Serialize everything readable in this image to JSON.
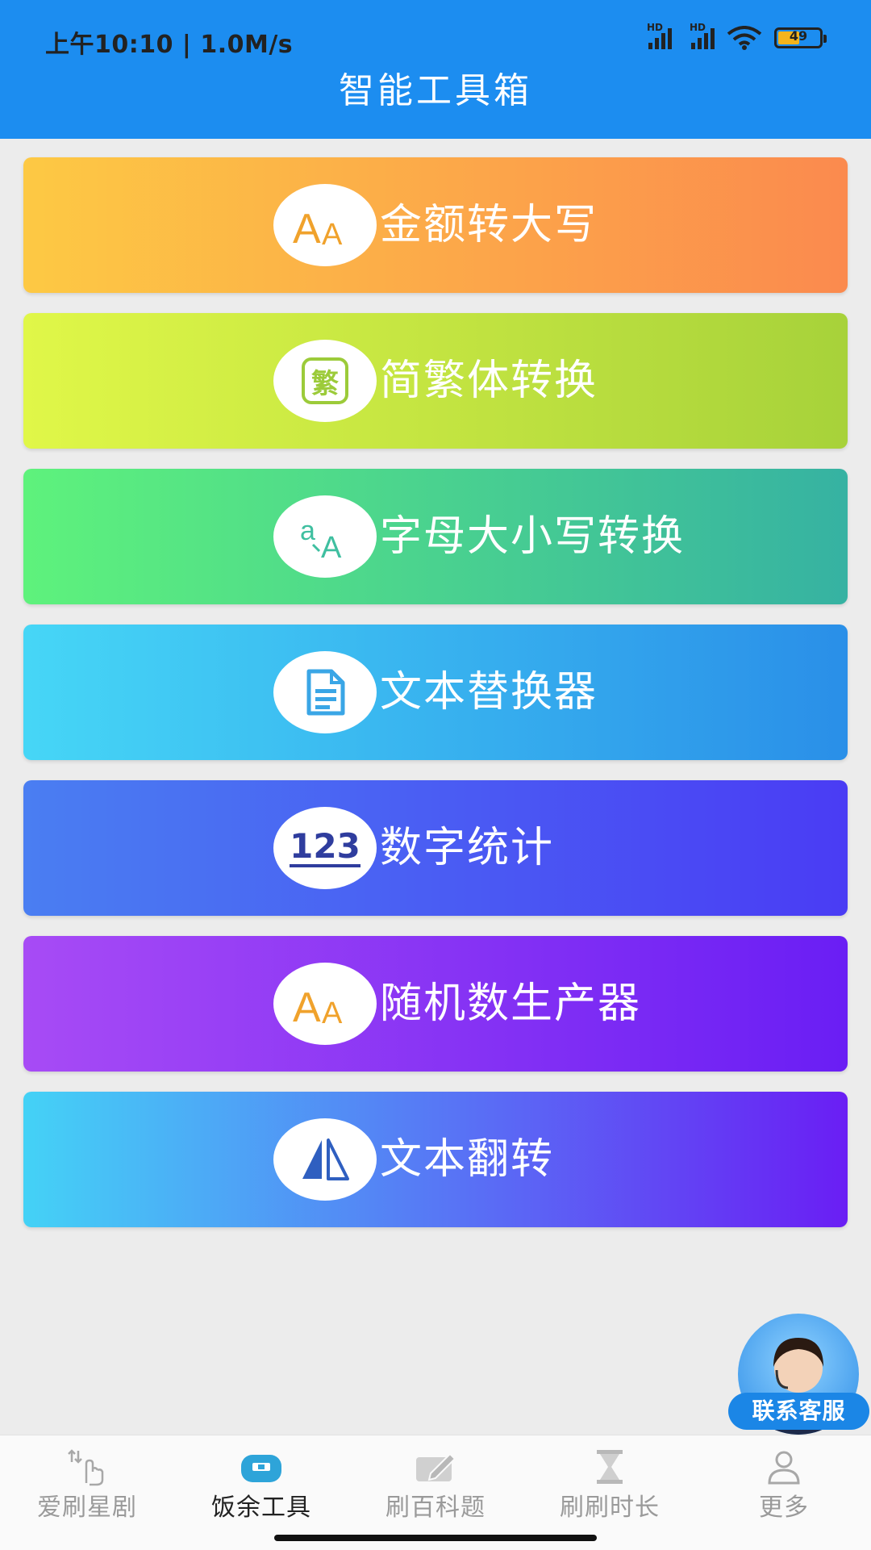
{
  "status": {
    "time": "上午10:10 | 1.0M/s",
    "battery": "49",
    "hd1": "HD",
    "hd2": "HD"
  },
  "header": {
    "title": "智能工具箱"
  },
  "tools": [
    {
      "label": "金额转大写",
      "icon": "font-aa-icon"
    },
    {
      "label": "简繁体转换",
      "icon": "traditional-char-icon",
      "icon_text": "繁"
    },
    {
      "label": "字母大小写转换",
      "icon": "translate-icon"
    },
    {
      "label": "文本替换器",
      "icon": "document-icon"
    },
    {
      "label": "数字统计",
      "icon": "number-123-icon",
      "icon_text": "123"
    },
    {
      "label": "随机数生产器",
      "icon": "font-aa-icon"
    },
    {
      "label": "文本翻转",
      "icon": "flip-icon"
    }
  ],
  "customer_service": {
    "label": "联系客服"
  },
  "tabbar": {
    "active_index": 1,
    "items": [
      {
        "label": "爱刷星剧",
        "icon": "swipe-hand-icon"
      },
      {
        "label": "饭余工具",
        "icon": "toolbox-icon"
      },
      {
        "label": "刷百科题",
        "icon": "edit-note-icon"
      },
      {
        "label": "刷刷时长",
        "icon": "hourglass-icon"
      },
      {
        "label": "更多",
        "icon": "user-icon"
      }
    ]
  },
  "colors": {
    "header": "#1c8df0",
    "accent_orange": "#f0a22c",
    "tab_active": "#2ea4d9"
  }
}
